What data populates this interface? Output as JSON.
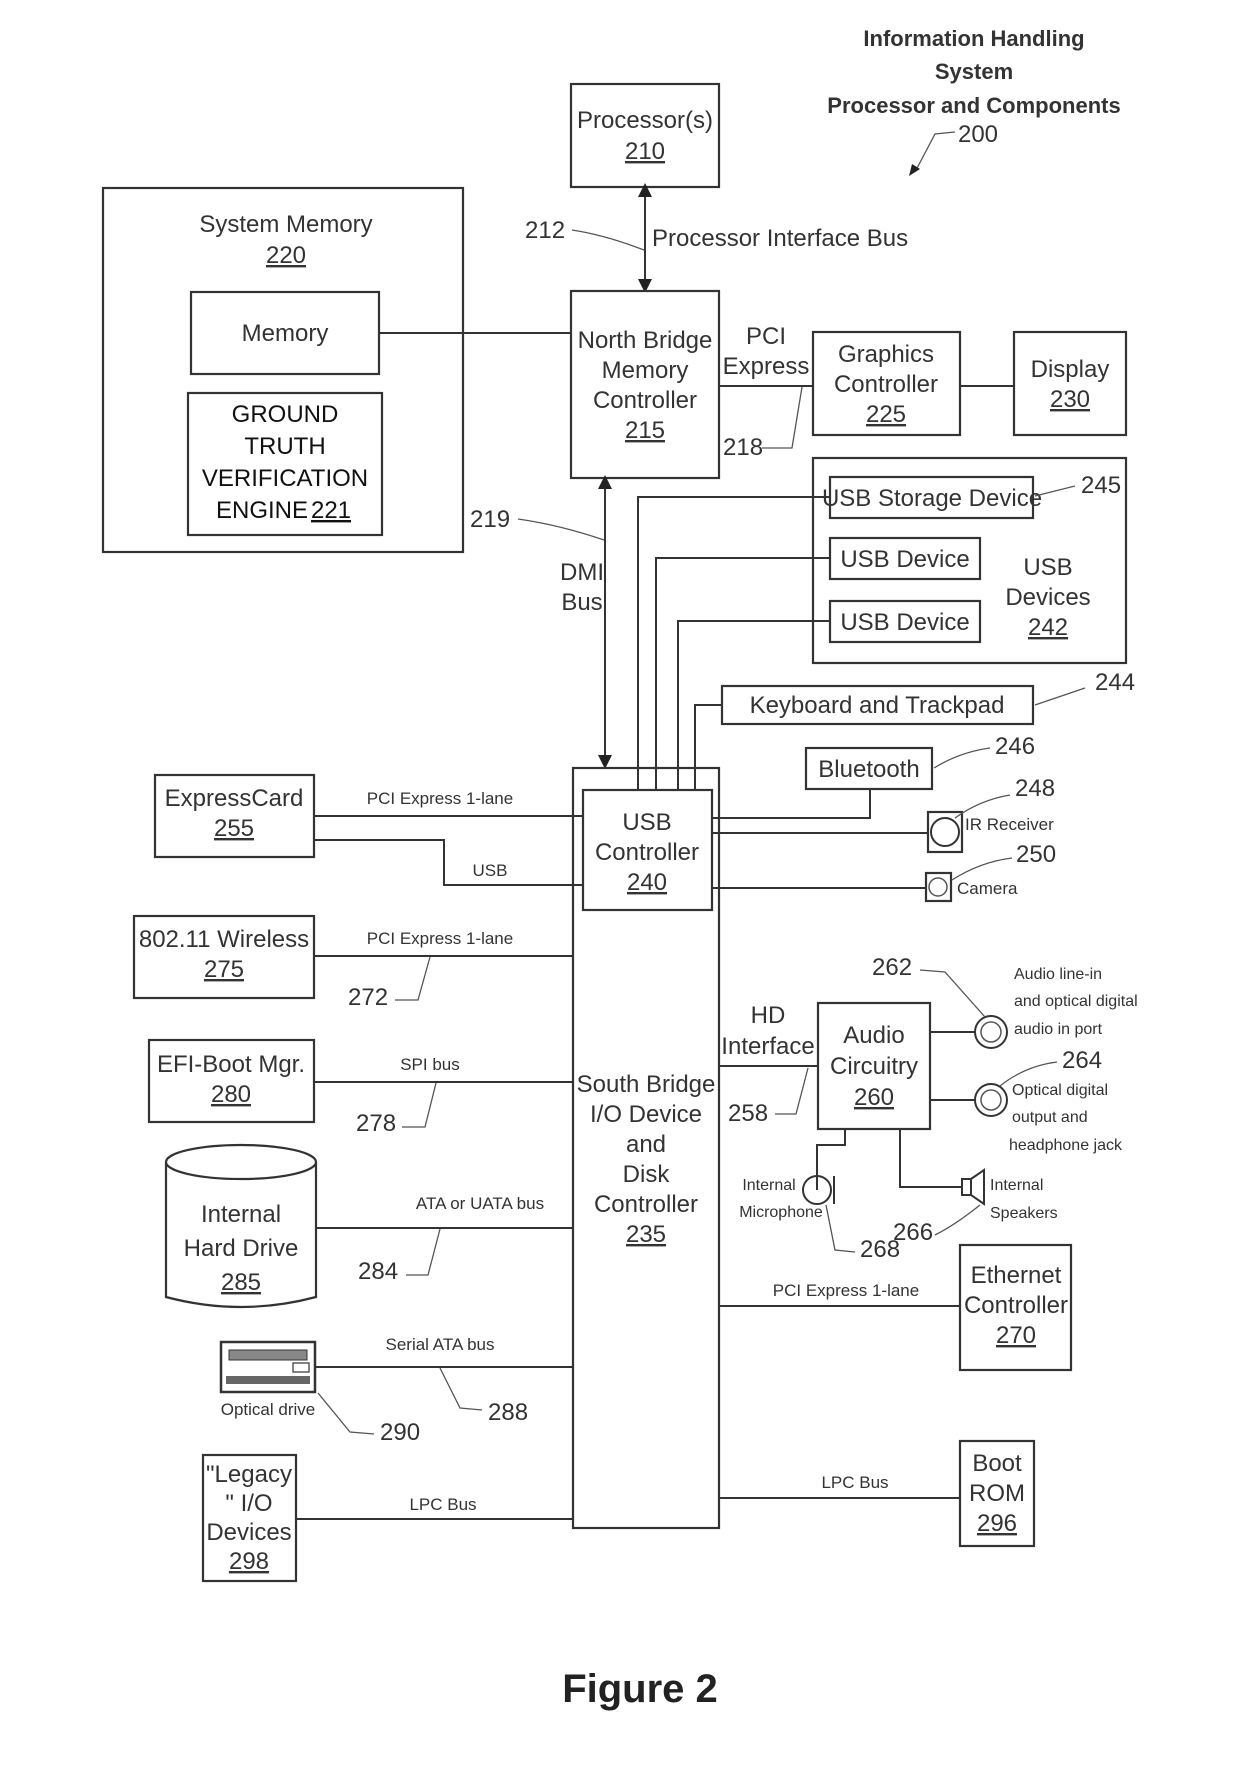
{
  "title": {
    "line1": "Information Handling",
    "line2": "System",
    "line3": "Processor and Components",
    "ref": "200"
  },
  "figure_label": "Figure 2",
  "components": {
    "processor": {
      "label": "Processor(s)",
      "ref": "210"
    },
    "system_memory": {
      "label": "System Memory",
      "ref": "220"
    },
    "memory": {
      "label": "Memory"
    },
    "gtv_engine": {
      "line1": "GROUND",
      "line2": "TRUTH",
      "line3": "VERIFICATION",
      "line4": "ENGINE",
      "ref": "221"
    },
    "north_bridge": {
      "line1": "North Bridge",
      "line2": "Memory",
      "line3": "Controller",
      "ref": "215"
    },
    "graphics": {
      "line1": "Graphics",
      "line2": "Controller",
      "ref": "225"
    },
    "display": {
      "label": "Display",
      "ref": "230"
    },
    "usb_devices": {
      "line1": "USB",
      "line2": "Devices",
      "ref": "242"
    },
    "usb_storage": {
      "label": "USB Storage Device",
      "ref": "245"
    },
    "usb_device_1": {
      "label": "USB Device"
    },
    "usb_device_2": {
      "label": "USB Device"
    },
    "keyboard": {
      "label": "Keyboard and Trackpad",
      "ref": "244"
    },
    "bluetooth": {
      "label": "Bluetooth",
      "ref": "246"
    },
    "ir_receiver": {
      "label": "IR Receiver",
      "ref": "248"
    },
    "camera": {
      "label": "Camera",
      "ref": "250"
    },
    "usb_controller": {
      "line1": "USB",
      "line2": "Controller",
      "ref": "240"
    },
    "south_bridge": {
      "line1": "South Bridge",
      "line2": "I/O Device",
      "line3": "and",
      "line4": "Disk",
      "line5": "Controller",
      "ref": "235"
    },
    "expresscard": {
      "label": "ExpressCard",
      "ref": "255"
    },
    "wireless": {
      "label": "802.11 Wireless",
      "ref": "275"
    },
    "efi_boot": {
      "label": "EFI-Boot Mgr.",
      "ref": "280"
    },
    "hard_drive": {
      "line1": "Internal",
      "line2": "Hard Drive",
      "ref": "285"
    },
    "optical_drive": {
      "label": "Optical drive",
      "ref": "290"
    },
    "legacy_io": {
      "line1": "\"Legacy",
      "line2": "\" I/O",
      "line3": "Devices",
      "ref": "298"
    },
    "audio": {
      "line1": "Audio",
      "line2": "Circuitry",
      "ref": "260"
    },
    "audio_line_in": {
      "line1": "Audio line-in",
      "line2": "and optical digital",
      "line3": "audio in port",
      "ref": "262"
    },
    "optical_out": {
      "line1": "Optical digital",
      "line2": "output and",
      "line3": "headphone jack",
      "ref": "264"
    },
    "speakers": {
      "line1": "Internal",
      "line2": "Speakers",
      "ref": "266"
    },
    "microphone": {
      "line1": "Internal",
      "line2": "Microphone",
      "ref": "268"
    },
    "ethernet": {
      "line1": "Ethernet",
      "line2": "Controller",
      "ref": "270"
    },
    "boot_rom": {
      "line1": "Boot",
      "line2": "ROM",
      "ref": "296"
    }
  },
  "buses": {
    "processor_bus": {
      "label": "Processor Interface Bus",
      "ref": "212"
    },
    "pci_express": {
      "line1": "PCI",
      "line2": "Express",
      "ref": "218"
    },
    "dmi": {
      "line1": "DMI",
      "line2": "Bus",
      "ref": "219"
    },
    "hd_interface": {
      "line1": "HD",
      "line2": "Interface",
      "ref": "258"
    },
    "expresscard_pcie": {
      "label": "PCI Express 1-lane"
    },
    "expresscard_usb": {
      "label": "USB"
    },
    "wireless_pcie": {
      "label": "PCI Express 1-lane",
      "ref": "272"
    },
    "spi": {
      "label": "SPI bus",
      "ref": "278"
    },
    "ata": {
      "label": "ATA or UATA bus",
      "ref": "284"
    },
    "sata": {
      "label": "Serial ATA bus",
      "ref": "288"
    },
    "lpc_left": {
      "label": "LPC Bus"
    },
    "ethernet_pcie": {
      "label": "PCI Express 1-lane"
    },
    "lpc_right": {
      "label": "LPC Bus"
    }
  }
}
